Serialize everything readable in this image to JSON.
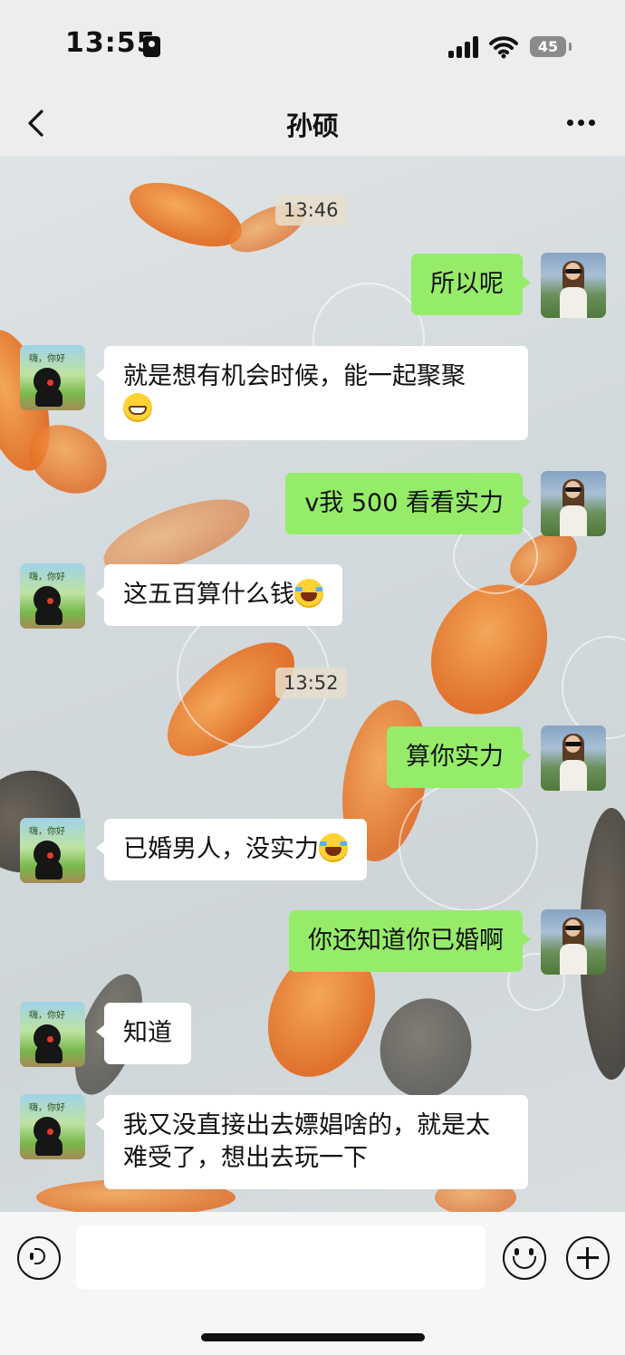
{
  "status_bar": {
    "time": "13:55",
    "battery": "45"
  },
  "header": {
    "title": "孙硕"
  },
  "messages": {
    "ts1": "13:46",
    "m1": "所以呢",
    "m2": "就是想有机会时候，能一起聚聚",
    "m3": "v我 500 看看实力",
    "m4": "这五百算什么钱",
    "ts2": "13:52",
    "m5": "算你实力",
    "m6": "已婚男人，没实力",
    "m7": "你还知道你已婚啊",
    "m8": "知道",
    "m9": "我又没直接出去嫖娼啥的，就是太难受了，想出去玩一下"
  },
  "avatar_text": "嗨，你好",
  "emoji_names": {
    "m2": "grin-emoji",
    "m4": "tears-of-joy-emoji",
    "m6": "crying-laughing-emoji"
  },
  "colors": {
    "sent_bubble": "#95ec69",
    "received_bubble": "#ffffff",
    "bar": "#ededed"
  },
  "input": {
    "value": ""
  }
}
